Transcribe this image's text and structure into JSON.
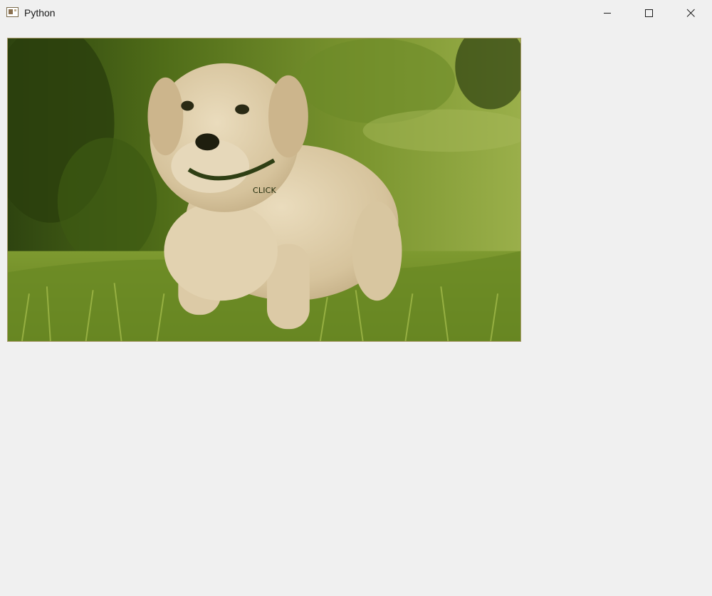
{
  "window": {
    "title": "Python",
    "controls": {
      "minimize_icon": "minimize-icon",
      "maximize_icon": "maximize-icon",
      "close_icon": "close-icon"
    }
  },
  "main": {
    "image_button": {
      "label": "CLICK",
      "image": "puppy-photo"
    }
  },
  "colors": {
    "window_bg": "#f0f0f0",
    "grass_dark": "#3f5a10",
    "grass_light": "#8aa23a",
    "puppy": "#dcc9a4"
  }
}
